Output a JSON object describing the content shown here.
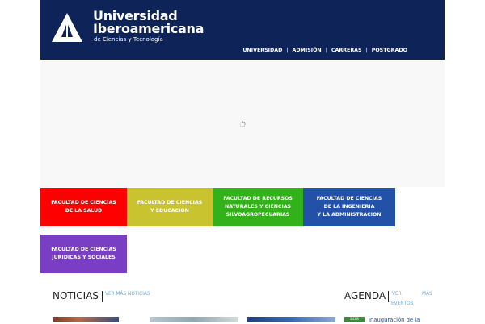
{
  "brand": {
    "line1": "Universidad",
    "line2": "Iberoamericana",
    "line3": "de Ciencias y Tecnología",
    "header_color": "#0e2459"
  },
  "topnav": {
    "items": [
      {
        "label": "UNIVERSIDAD"
      },
      {
        "label": "ADMISIÓN"
      },
      {
        "label": "CARRERAS"
      },
      {
        "label": "POSTGRADO"
      }
    ],
    "separator": "|"
  },
  "faculties": [
    {
      "label": "FACULTAD DE CIENCIAS\nDE LA SALUD",
      "color": "#ff0000"
    },
    {
      "label": "FACULTAD DE CIENCIAS\nY EDUCACION",
      "color": "#c8c32e"
    },
    {
      "label": "FACULTAD DE RECURSOS\nNATURALES Y CIENCIAS\nSILVOAGROPECUARIAS",
      "color": "#33b11a"
    },
    {
      "label": "FACULTAD DE CIENCIAS\nDE LA INGENIERIA\nY LA ADMINISTRACION",
      "color": "#2451a8"
    },
    {
      "label": "FACULTAD DE CIENCIAS\nJURIDICAS Y SOCIALES",
      "color": "#7a3ec4"
    }
  ],
  "news": {
    "title": "NOTICIAS",
    "more": "VER MÁS NOTICIAS"
  },
  "agenda": {
    "title": "AGENDA",
    "more_part1": "VER",
    "more_part2": "MÁS",
    "more_part3": "EVENTOS",
    "event_badge": "LOS",
    "event_title": "Inauguración de la"
  }
}
